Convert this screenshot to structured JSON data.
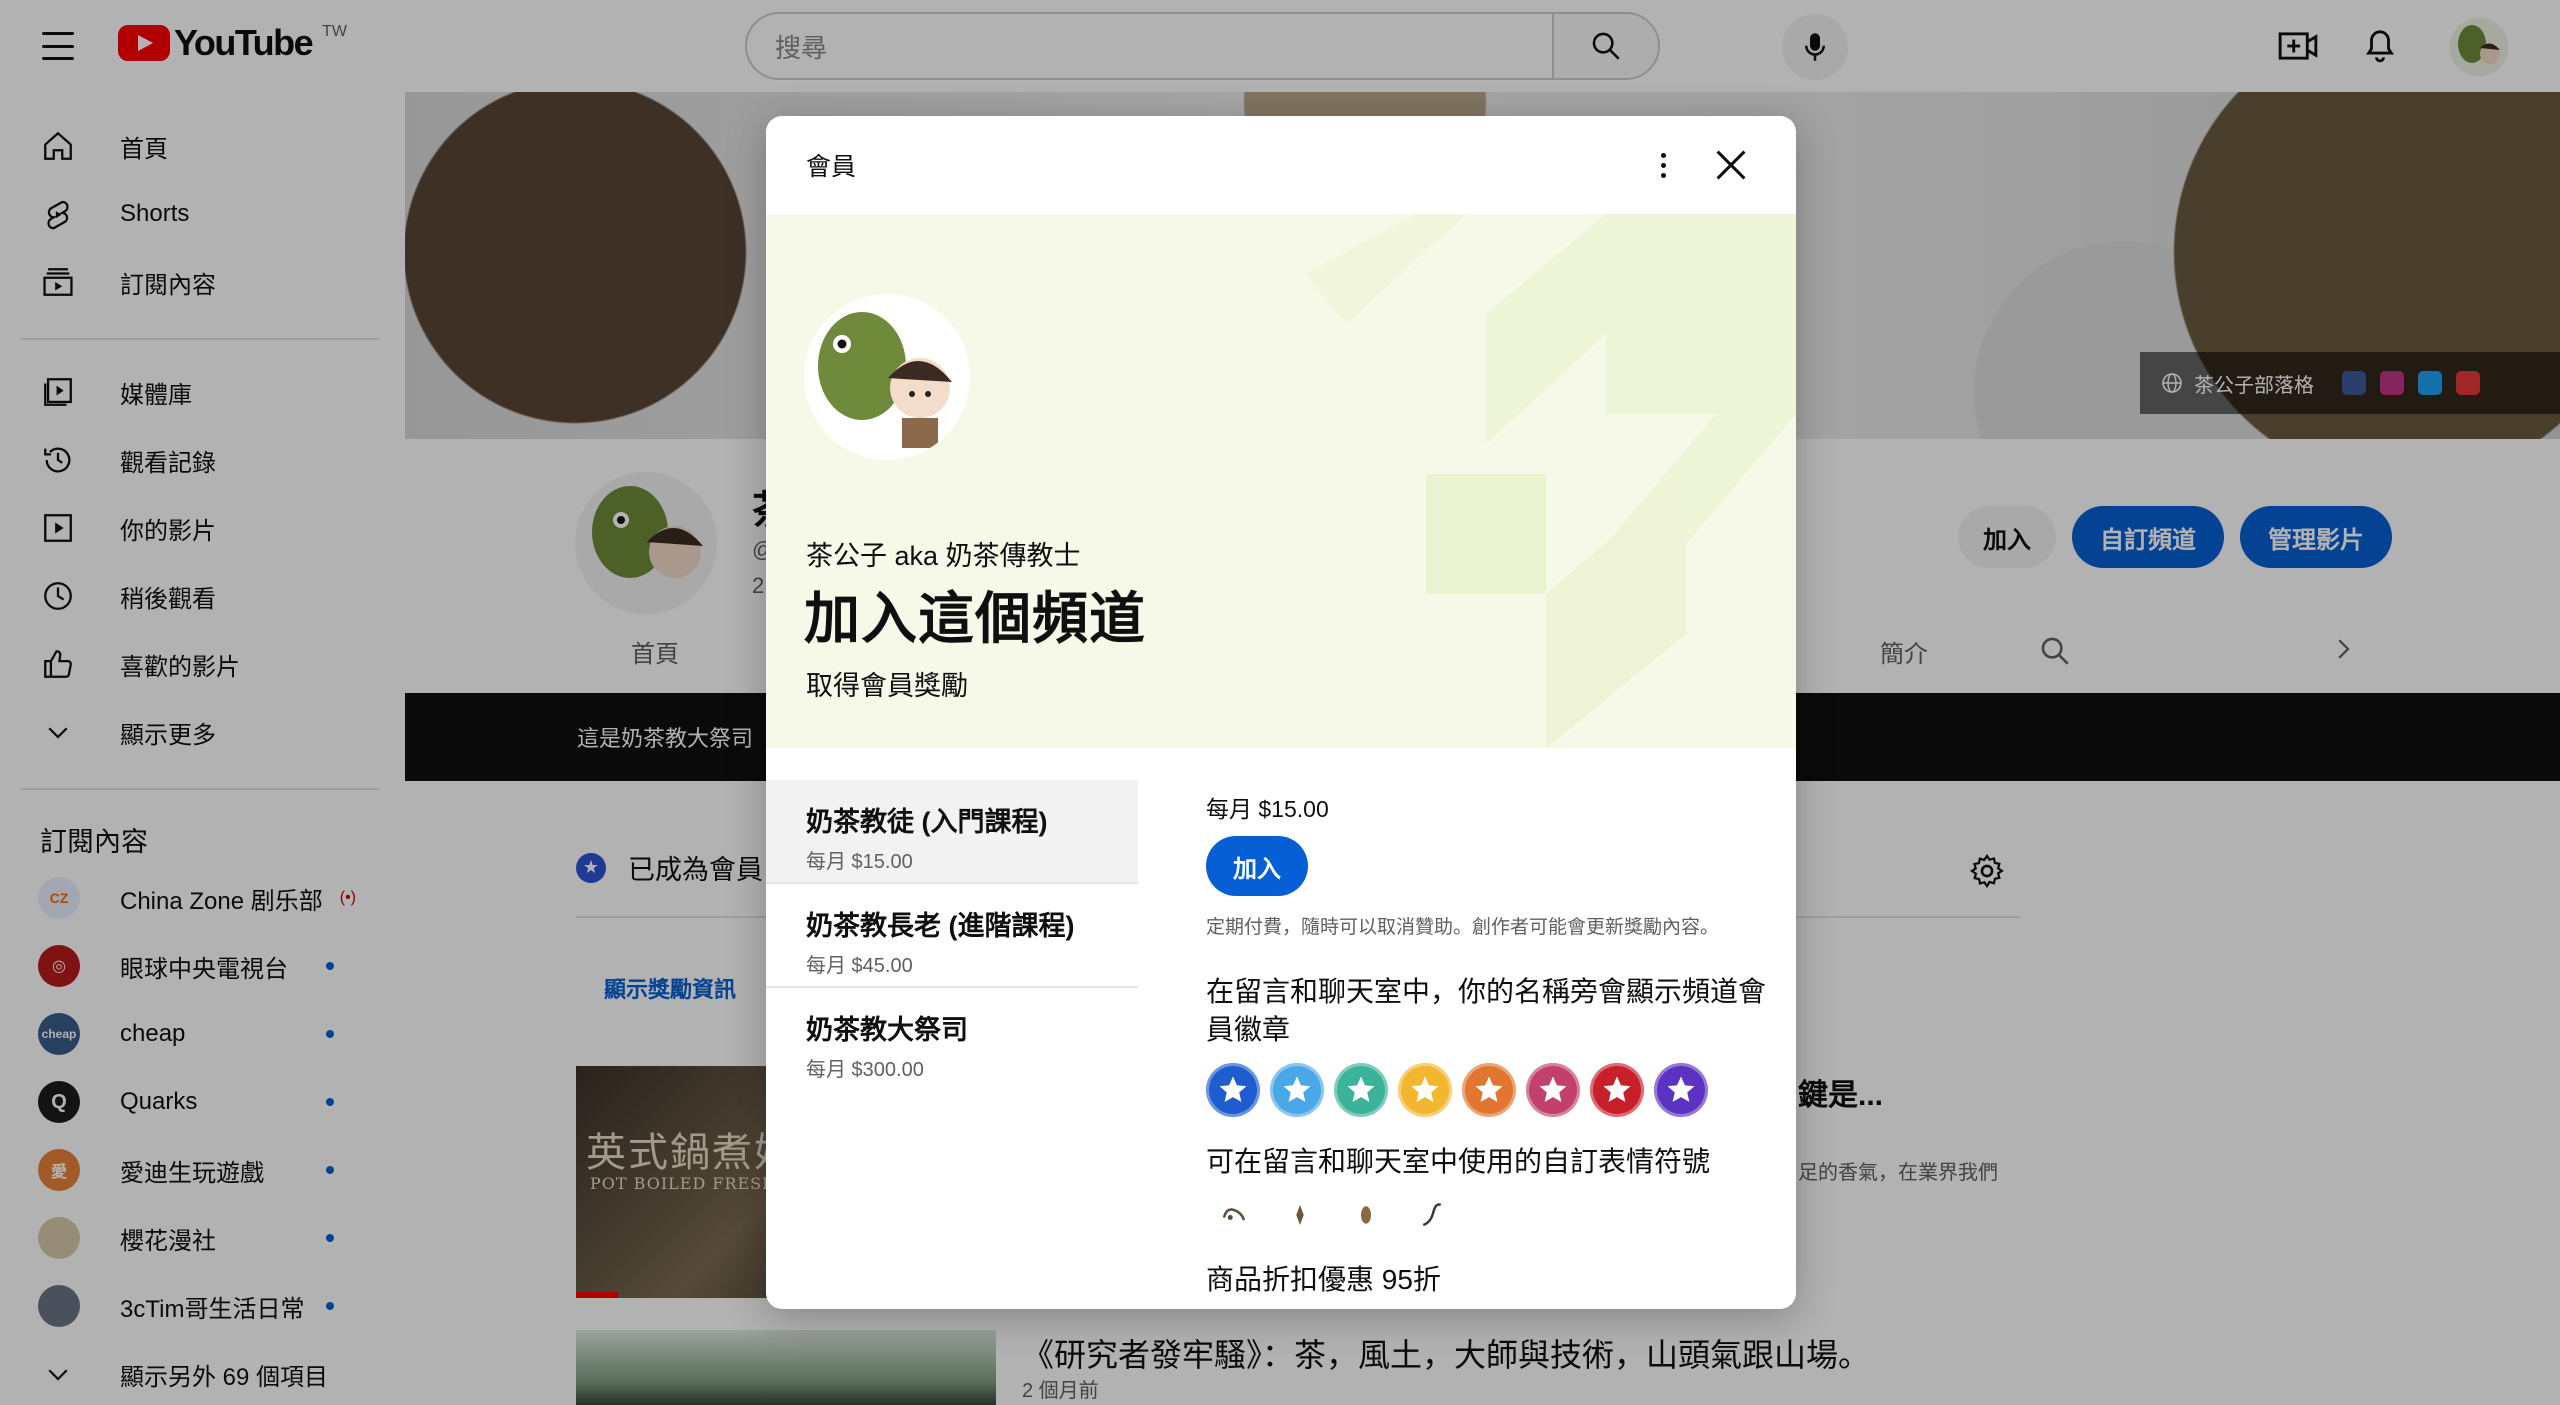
{
  "header": {
    "logo_text": "YouTube",
    "country_code": "TW",
    "search_placeholder": "搜尋"
  },
  "sidebar": {
    "primary": [
      {
        "label": "首頁",
        "icon": "home-icon"
      },
      {
        "label": "Shorts",
        "icon": "shorts-icon"
      },
      {
        "label": "訂閱內容",
        "icon": "subscriptions-icon"
      }
    ],
    "secondary": [
      {
        "label": "媒體庫",
        "icon": "library-icon"
      },
      {
        "label": "觀看記錄",
        "icon": "history-icon"
      },
      {
        "label": "你的影片",
        "icon": "your-videos-icon"
      },
      {
        "label": "稍後觀看",
        "icon": "watch-later-icon"
      },
      {
        "label": "喜歡的影片",
        "icon": "liked-icon"
      },
      {
        "label": "顯示更多",
        "icon": "chevron-down-icon"
      }
    ],
    "subscriptions_heading": "訂閱內容",
    "subscriptions": [
      {
        "label": "China Zone 剧乐部",
        "color": "#e8f0ff",
        "status": "live",
        "live_label": "(•)"
      },
      {
        "label": "眼球中央電視台",
        "color": "#b71c1c",
        "status": "new"
      },
      {
        "label": "cheap",
        "color": "#3b5d8c",
        "status": "new"
      },
      {
        "label": "Quarks",
        "color": "#1c1c1c",
        "status": "new"
      },
      {
        "label": "愛迪生玩遊戲",
        "color": "#e8833a",
        "status": "new"
      },
      {
        "label": "櫻花漫社",
        "color": "#d9c9a8",
        "status": "new"
      },
      {
        "label": "3cTim哥生活日常",
        "color": "#6b7486",
        "status": "new"
      }
    ],
    "show_more_subs": "顯示另外 69 個項目"
  },
  "channel": {
    "banner_link": "茶公子部落格",
    "social_colors": [
      "#3b5998",
      "#c13584",
      "#1da1f2",
      "#e53935"
    ],
    "name_stub": "茶",
    "handle_stub": "@",
    "subs_stub": "2",
    "buttons": {
      "join": "加入",
      "customize": "自訂頻道",
      "manage": "管理影片"
    },
    "tabs": {
      "home": "首頁",
      "about": "簡介"
    },
    "strip_text": "這是奶茶教大祭司",
    "member_status": "已成為會員",
    "perks_link": "顯示獎勵資訊",
    "video1_thumb_title": "英式鍋煮奶",
    "video1_thumb_sub": "POT BOILED FRESH M",
    "video1_title_tail": "鍵是...",
    "video1_desc_tail": "足的香氣，在業界我們",
    "video2_title": "《研究者發牢騷》：茶，風土，大師與技術，山頭氣跟山場。",
    "video2_meta": "2 個月前"
  },
  "dialog": {
    "title": "會員",
    "channel_name": "茶公子 aka 奶茶傳教士",
    "headline": "加入這個頻道",
    "subheadline": "取得會員獎勵",
    "tiers": [
      {
        "name": "奶茶教徒 (入門課程)",
        "price": "每月 $15.00",
        "selected": true
      },
      {
        "name": "奶茶教長老 (進階課程)",
        "price": "每月 $45.00",
        "selected": false
      },
      {
        "name": "奶茶教大祭司",
        "price": "每月 $300.00",
        "selected": false
      }
    ],
    "detail": {
      "price": "每月 $15.00",
      "join_label": "加入",
      "fine_print": "定期付費，隨時可以取消贊助。創作者可能會更新獎勵內容。",
      "perk_badges": "在留言和聊天室中，你的名稱旁會顯示頻道會員徽章",
      "badge_colors": [
        "#1f5ccf",
        "#4aa8e8",
        "#3bb39a",
        "#f2b72f",
        "#e2752f",
        "#c2406b",
        "#c8202b",
        "#5b32c2"
      ],
      "perk_emoji": "可在留言和聊天室中使用的自訂表情符號",
      "perk_discount": "商品折扣優惠 95折"
    }
  }
}
